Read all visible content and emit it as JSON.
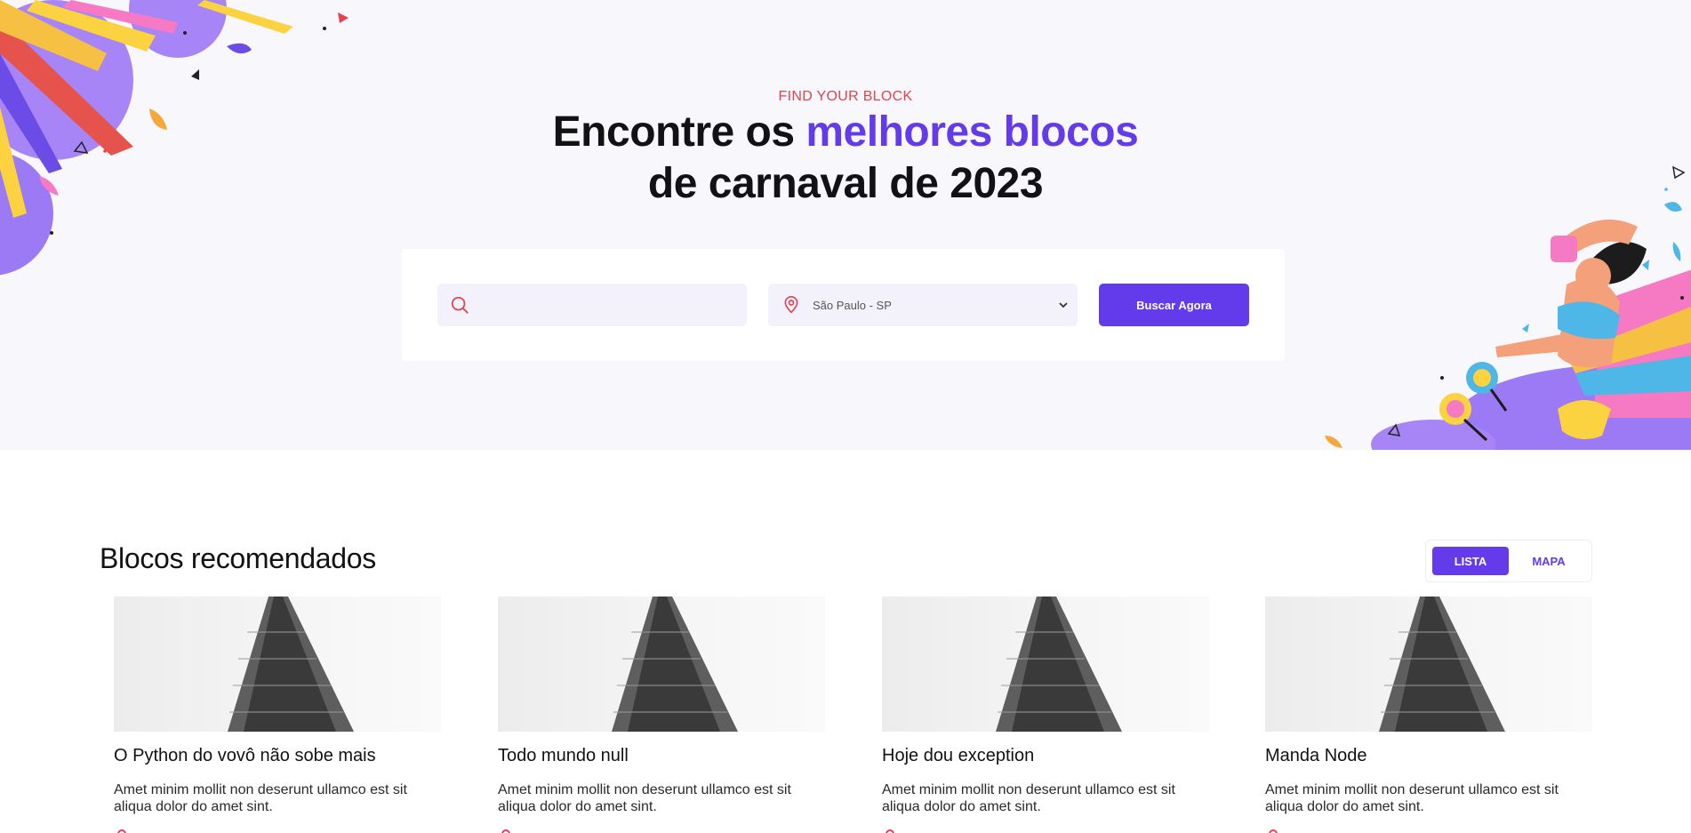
{
  "hero": {
    "eyebrow": "FIND YOUR BLOCK",
    "headline_part1": "Encontre os ",
    "headline_accent": "melhores blocos",
    "headline_line2": "de carnaval de 2023"
  },
  "search": {
    "text_value": "",
    "text_placeholder": "",
    "text_icon": "search-icon",
    "location_icon": "map-pin-icon",
    "location_selected": "São Paulo - SP",
    "location_arrow_icon": "chevron-down-icon",
    "button_label": "Buscar Agora"
  },
  "section": {
    "title": "Blocos recomendados",
    "toggle_active": "LISTA",
    "toggle_inactive": "MAPA"
  },
  "cards": [
    {
      "title": "O Python do vovô não sobe mais",
      "description": "Amet minim mollit non deserunt ullamco est sit aliqua dolor do amet sint."
    },
    {
      "title": "Todo mundo null",
      "description": "Amet minim mollit non deserunt ullamco est sit aliqua dolor do amet sint."
    },
    {
      "title": "Hoje dou exception",
      "description": "Amet minim mollit non deserunt ullamco est sit aliqua dolor do amet sint."
    },
    {
      "title": "Manda Node",
      "description": "Amet minim mollit non deserunt ullamco est sit aliqua dolor do amet sint."
    }
  ],
  "colors": {
    "brand": "#633bea",
    "accent_red": "#e4434d",
    "hero_bg": "#f7f7fc",
    "field_bg": "#f3f2fc",
    "text": "#121214"
  }
}
